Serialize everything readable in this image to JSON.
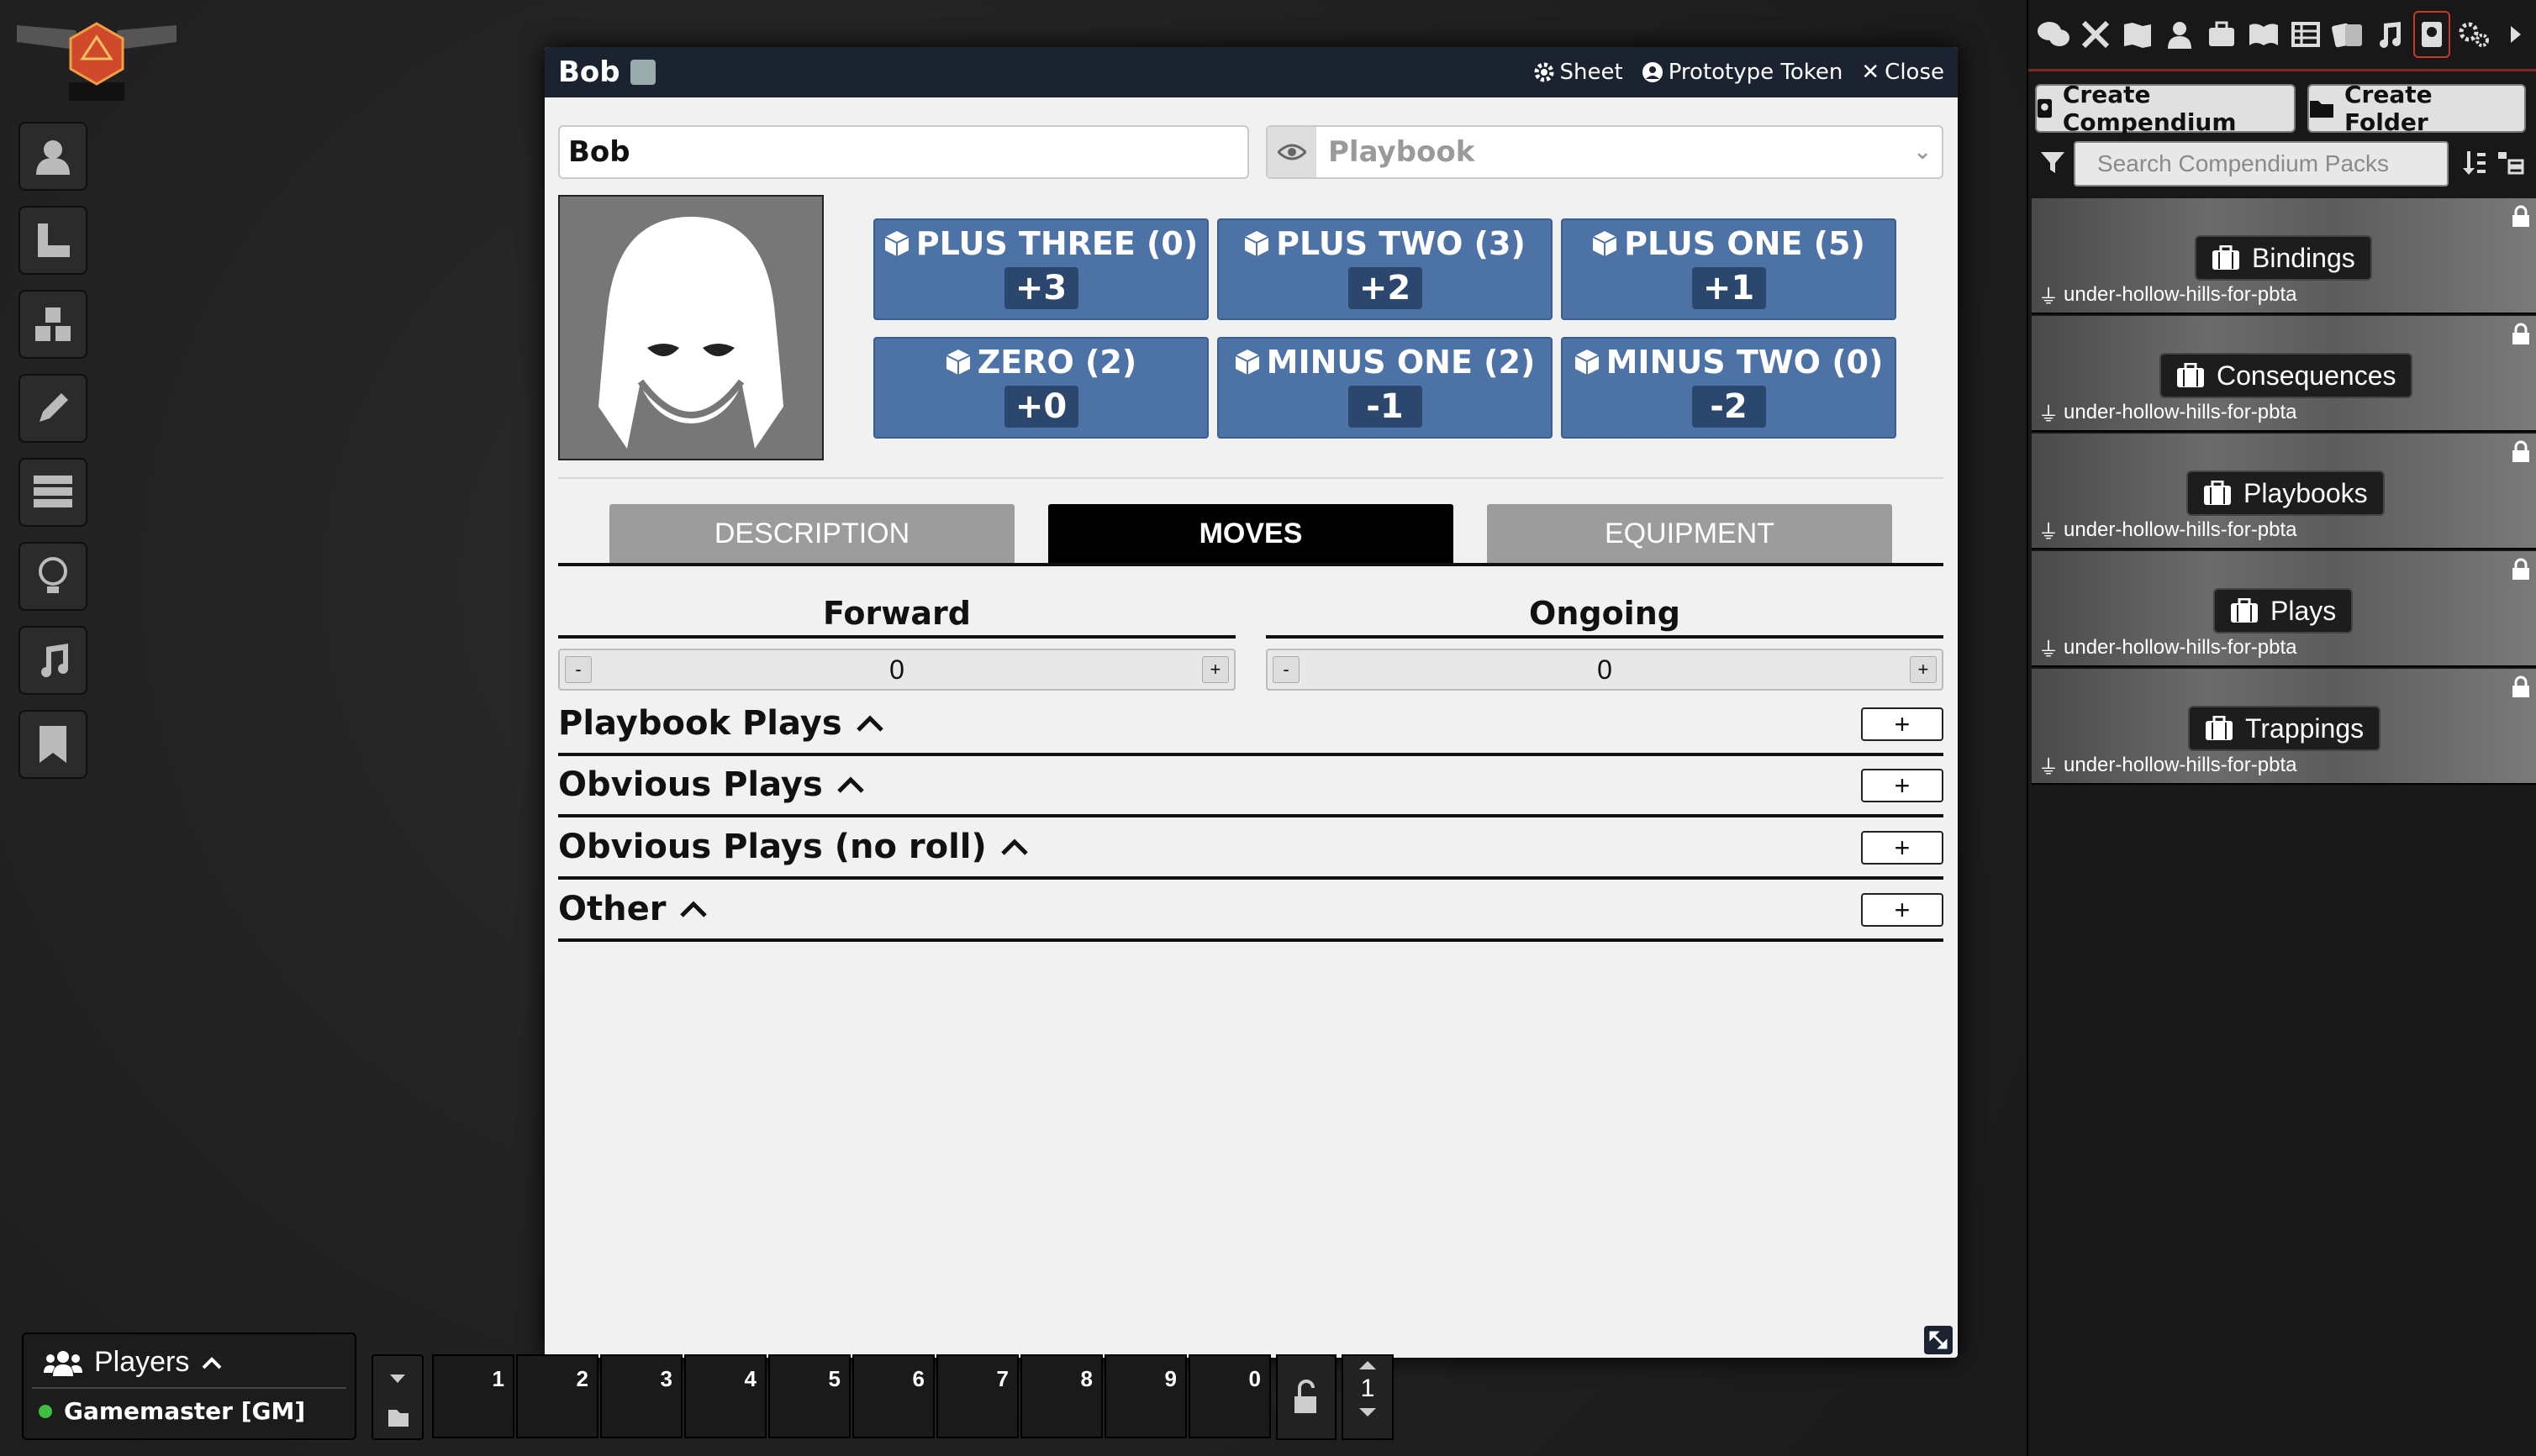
{
  "sheet": {
    "title": "Bob",
    "header_links": {
      "sheet": "Sheet",
      "prototype_token": "Prototype Token",
      "close": "Close"
    },
    "name_value": "Bob",
    "playbook_placeholder": "Playbook",
    "stats": [
      {
        "label": "PLUS THREE (0)",
        "value": "+3"
      },
      {
        "label": "PLUS TWO (3)",
        "value": "+2"
      },
      {
        "label": "PLUS ONE (5)",
        "value": "+1"
      },
      {
        "label": "ZERO (2)",
        "value": "+0"
      },
      {
        "label": "MINUS ONE (2)",
        "value": "-1"
      },
      {
        "label": "MINUS TWO (0)",
        "value": "-2"
      }
    ],
    "tabs": [
      "DESCRIPTION",
      "MOVES",
      "EQUIPMENT"
    ],
    "active_tab": "MOVES",
    "forward": {
      "label": "Forward",
      "value": "0"
    },
    "ongoing": {
      "label": "Ongoing",
      "value": "0"
    },
    "move_groups": [
      "Playbook Plays",
      "Obvious Plays",
      "Obvious Plays (no roll)",
      "Other"
    ]
  },
  "players": {
    "title": "Players",
    "entries": [
      "Gamemaster [GM]"
    ]
  },
  "hotbar": {
    "slots": [
      "1",
      "2",
      "3",
      "4",
      "5",
      "6",
      "7",
      "8",
      "9",
      "0"
    ],
    "page": "1"
  },
  "sidebar": {
    "create_compendium": "Create Compendium",
    "create_folder": "Create Folder",
    "search_placeholder": "Search Compendium Packs",
    "packs": [
      {
        "name": "Bindings",
        "source": "under-hollow-hills-for-pbta"
      },
      {
        "name": "Consequences",
        "source": "under-hollow-hills-for-pbta"
      },
      {
        "name": "Playbooks",
        "source": "under-hollow-hills-for-pbta"
      },
      {
        "name": "Plays",
        "source": "under-hollow-hills-for-pbta"
      },
      {
        "name": "Trappings",
        "source": "under-hollow-hills-for-pbta"
      }
    ],
    "tab_icons": [
      "chat-icon",
      "combat-icon",
      "scenes-icon",
      "actors-icon",
      "items-icon",
      "journal-icon",
      "tables-icon",
      "cards-icon",
      "playlists-icon",
      "compendium-icon",
      "settings-icon"
    ],
    "active_tab": "compendium-icon"
  },
  "colors": {
    "stat_blue": "#4d72a6",
    "header_dark": "#1b2330",
    "accent_red": "#c5382a"
  }
}
